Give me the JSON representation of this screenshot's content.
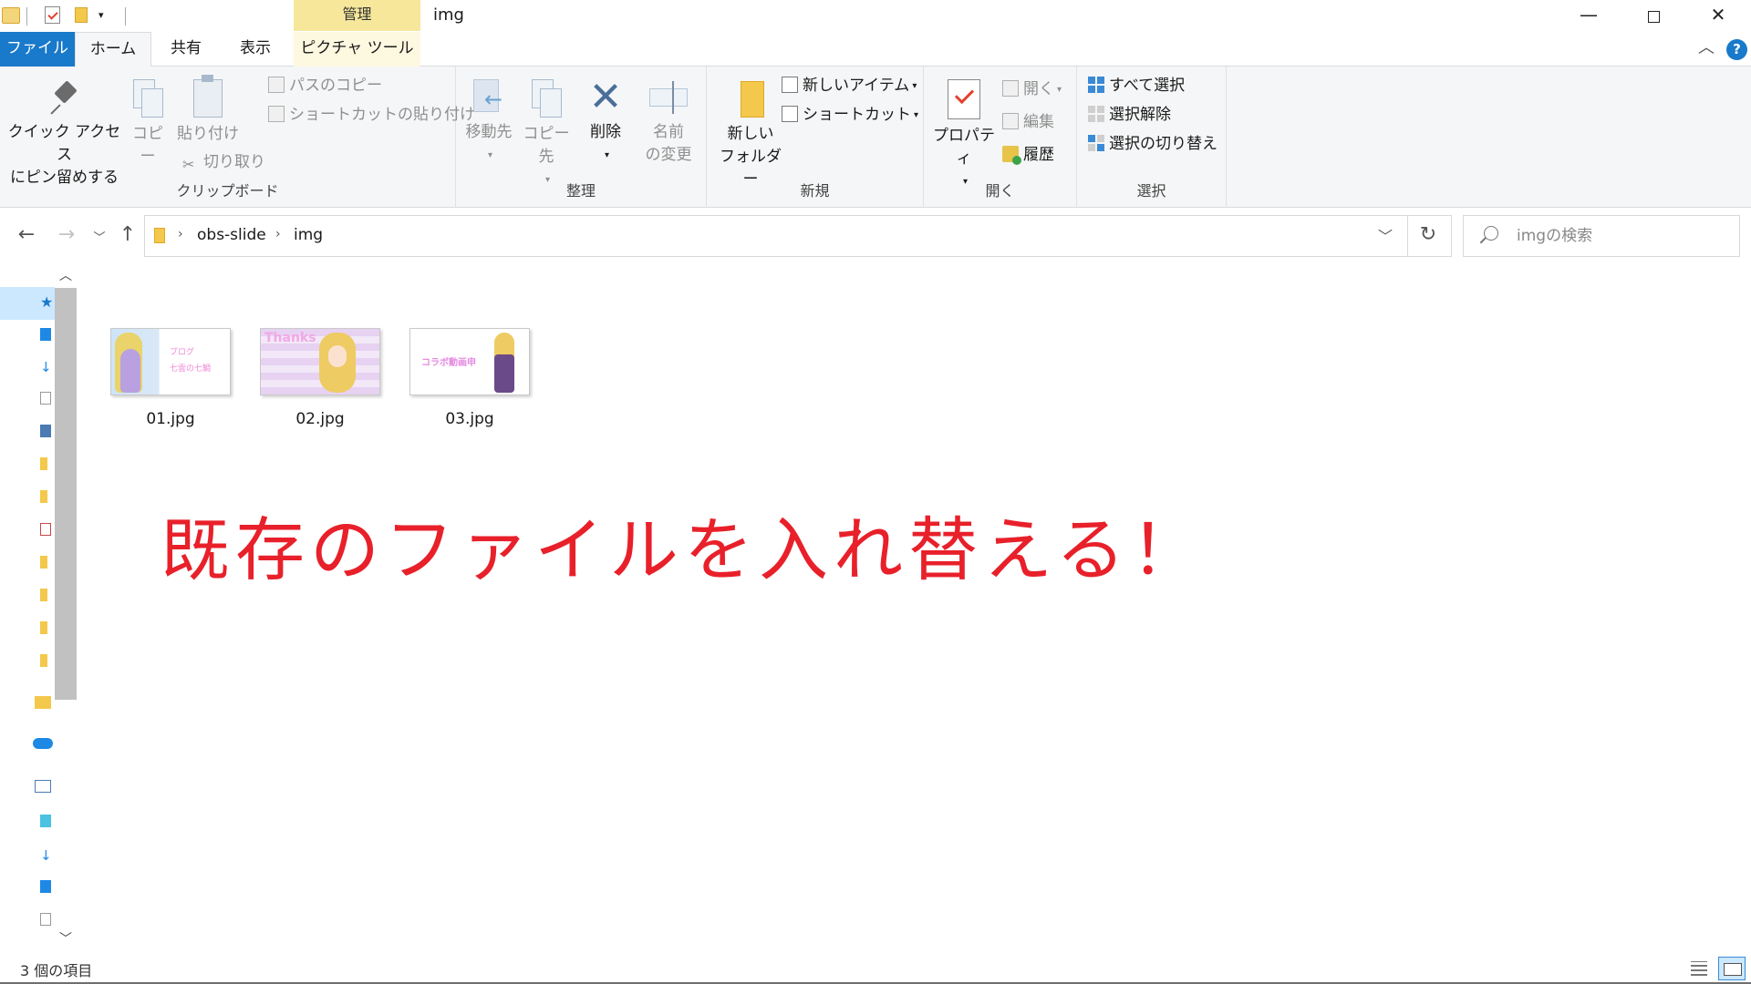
{
  "window": {
    "title": "img",
    "context_tab_header": "管理",
    "minimize": "—",
    "close": "✕"
  },
  "tabs": {
    "file": "ファイル",
    "home": "ホーム",
    "share": "共有",
    "view": "表示",
    "picture_tools": "ピクチャ ツール"
  },
  "ribbon": {
    "clipboard": {
      "label": "クリップボード",
      "pin_line1": "クイック アクセス",
      "pin_line2": "にピン留めする",
      "copy": "コピー",
      "paste": "貼り付け",
      "copy_path": "パスのコピー",
      "paste_shortcut": "ショートカットの貼り付け",
      "cut": "切り取り"
    },
    "organize": {
      "label": "整理",
      "move_to": "移動先",
      "copy_to": "コピー先",
      "delete": "削除",
      "rename_line1": "名前",
      "rename_line2": "の変更"
    },
    "new": {
      "label": "新規",
      "new_folder_line1": "新しい",
      "new_folder_line2": "フォルダー",
      "new_item": "新しいアイテム",
      "easy_access": "ショートカット"
    },
    "open": {
      "label": "開く",
      "properties": "プロパティ",
      "open": "開く",
      "edit": "編集",
      "history": "履歴"
    },
    "select": {
      "label": "選択",
      "select_all": "すべて選択",
      "select_none": "選択解除",
      "invert": "選択の切り替え"
    }
  },
  "address": {
    "crumbs": [
      "obs-slide",
      "img"
    ]
  },
  "search": {
    "placeholder": "imgの検索"
  },
  "files": [
    {
      "name": "01.jpg",
      "thumb_text_1": "ブログ",
      "thumb_text_2": "七雲の七鯛"
    },
    {
      "name": "02.jpg",
      "thumb_text_1": "Thanks"
    },
    {
      "name": "03.jpg",
      "thumb_text_1": "コラボ動画申"
    }
  ],
  "annotation": "既存のファイルを入れ替える！",
  "status": {
    "item_count": "3 個の項目"
  },
  "colors": {
    "accent": "#1979ca",
    "context_tab": "#f6e79b",
    "annotation": "#e8202a",
    "selection": "#cce8ff"
  },
  "icons": [
    "pin-icon",
    "copy-icon",
    "paste-icon",
    "move-icon",
    "delete-icon",
    "rename-icon",
    "folder-icon",
    "properties-icon",
    "search-icon",
    "refresh-icon",
    "help-icon"
  ]
}
